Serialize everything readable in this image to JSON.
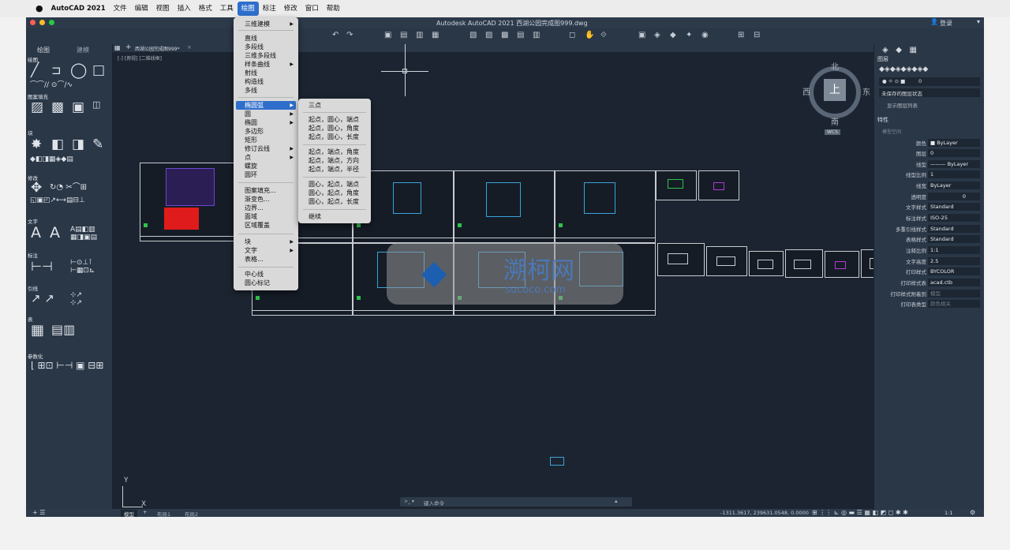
{
  "menubar": {
    "apple": "",
    "app": "AutoCAD 2021",
    "items": [
      "文件",
      "编辑",
      "视图",
      "插入",
      "格式",
      "工具",
      "绘图",
      "标注",
      "修改",
      "窗口",
      "帮助"
    ]
  },
  "window": {
    "title": "Autodesk AutoCAD 2021   西湖公园完成图999.dwg",
    "login": "登录"
  },
  "left_panel": {
    "tabs": [
      "绘图",
      "建模"
    ],
    "sections": [
      "绘图",
      "图案填充",
      "块",
      "修改",
      "文字",
      "标注",
      "引线",
      "表",
      "参数化"
    ]
  },
  "doc_tab": {
    "label": "西湖公园完成图999*",
    "viewport": "[-] [俯视] [二维线框]"
  },
  "viewcube": {
    "north": "北",
    "south": "南",
    "east": "东",
    "west": "西",
    "top": "上",
    "wcs": "WCS"
  },
  "menu_draw": {
    "items": [
      "三维建模",
      "直线",
      "多段线",
      "三维多段线",
      "样条曲线",
      "射线",
      "构造线",
      "多线",
      "椭圆弧",
      "圆",
      "椭圆",
      "多边形",
      "矩形",
      "修订云线",
      "点",
      "螺旋",
      "圆环",
      "图案填充...",
      "渐变色...",
      "边界...",
      "面域",
      "区域覆盖",
      "块",
      "文字",
      "表格...",
      "中心线",
      "圆心标记"
    ]
  },
  "menu_arc": {
    "items": [
      "三点",
      "起点，圆心，端点",
      "起点，圆心，角度",
      "起点，圆心，长度",
      "起点，端点，角度",
      "起点，端点，方向",
      "起点，端点，半径",
      "圆心，起点，端点",
      "圆心，起点，角度",
      "圆心，起点，长度",
      "继续"
    ]
  },
  "right_panel": {
    "layers_title": "图层",
    "layer_value": "0",
    "layer_state": "未保存的图层状态",
    "show_list": "显示图层列表",
    "props_title": "特性",
    "model_space": "模型空间",
    "props": [
      [
        "颜色",
        "■ ByLayer"
      ],
      [
        "图层",
        "0"
      ],
      [
        "线型",
        "——— ByLayer"
      ],
      [
        "线型比例",
        "1"
      ],
      [
        "线宽",
        "ByLayer"
      ],
      [
        "透明度",
        "0"
      ],
      [
        "文字样式",
        "Standard"
      ],
      [
        "标注样式",
        "ISO-25"
      ],
      [
        "多重引线样式",
        "Standard"
      ],
      [
        "表格样式",
        "Standard"
      ],
      [
        "注释比例",
        "1:1"
      ],
      [
        "文字高度",
        "2.5"
      ],
      [
        "打印样式",
        "BYCOLOR"
      ],
      [
        "打印样式表",
        "acad.ctb"
      ],
      [
        "打印样式附着到",
        "模型"
      ],
      [
        "打印表类型",
        "颜色相关"
      ]
    ]
  },
  "command": {
    "placeholder": "键入命令"
  },
  "status": {
    "tabs": [
      "模型",
      "布局1",
      "布局2"
    ],
    "coords": "-1311.3617, 239631.0548, 0.0000",
    "scale": "1:1"
  },
  "watermark": {
    "text": "溯柯网",
    "sub": "sucoco.com"
  }
}
